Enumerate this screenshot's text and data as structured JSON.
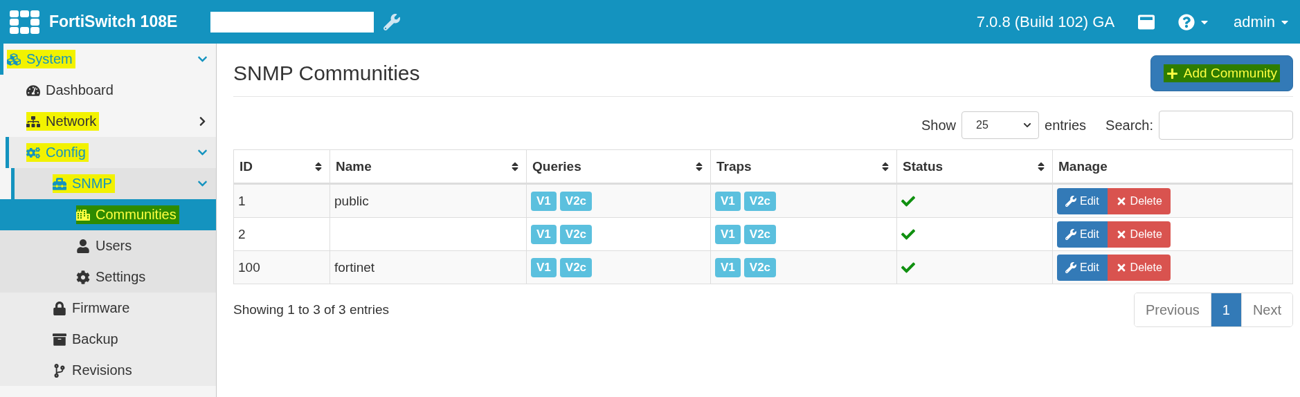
{
  "header": {
    "product": "FortiSwitch 108E",
    "version": "7.0.8 (Build 102) GA",
    "user": "admin"
  },
  "sidebar": {
    "items": [
      {
        "label": "System",
        "selected": false,
        "expanded": true,
        "color": "#f2f200",
        "children": [
          {
            "label": "Dashboard",
            "selected": false
          },
          {
            "label": "Network",
            "selected": false,
            "expanded": false,
            "color": "#f2f200"
          },
          {
            "label": "Config",
            "selected": false,
            "expanded": true,
            "color": "#f2f200",
            "children": [
              {
                "label": "SNMP",
                "selected": false,
                "expanded": true,
                "color": "#f2f200",
                "children": [
                  {
                    "label": "Communities",
                    "selected": true,
                    "color": "#2e8b00"
                  },
                  {
                    "label": "Users",
                    "selected": false
                  },
                  {
                    "label": "Settings",
                    "selected": false
                  }
                ]
              },
              {
                "label": "Firmware",
                "selected": false
              },
              {
                "label": "Backup",
                "selected": false
              },
              {
                "label": "Revisions",
                "selected": false
              }
            ]
          }
        ]
      }
    ]
  },
  "page": {
    "title": "SNMP Communities",
    "add_button": {
      "label": "Add Community",
      "color": "#2e7d00"
    }
  },
  "controls": {
    "show_label": "Show",
    "page_size": "25",
    "entries_label": "entries",
    "search_label": "Search:"
  },
  "table": {
    "columns": [
      "ID",
      "Name",
      "Queries",
      "Traps",
      "Status",
      "Manage"
    ],
    "rows": [
      {
        "id": "1",
        "name": "public",
        "queries": [
          "V1",
          "V2c"
        ],
        "traps": [
          "V1",
          "V2c"
        ],
        "enabled": true,
        "actions": [
          "Edit",
          "Delete"
        ]
      },
      {
        "id": "2",
        "queries": [
          "V1",
          "V2c"
        ],
        "traps": [
          "V1",
          "V2c"
        ],
        "enabled": true,
        "actions": [
          "Edit",
          "Delete"
        ]
      },
      {
        "id": "100",
        "name": "fortinet",
        "queries": [
          "V1",
          "V2c"
        ],
        "traps": [
          "V1",
          "V2c"
        ],
        "enabled": true,
        "actions": [
          "Edit",
          "Delete"
        ]
      }
    ]
  },
  "footer": {
    "info": "Showing 1 to 3 of 3 entries",
    "pagination": [
      {
        "label": "Previous",
        "selected": false
      },
      {
        "label": "1",
        "selected": true
      },
      {
        "label": "Next",
        "selected": false
      }
    ]
  }
}
